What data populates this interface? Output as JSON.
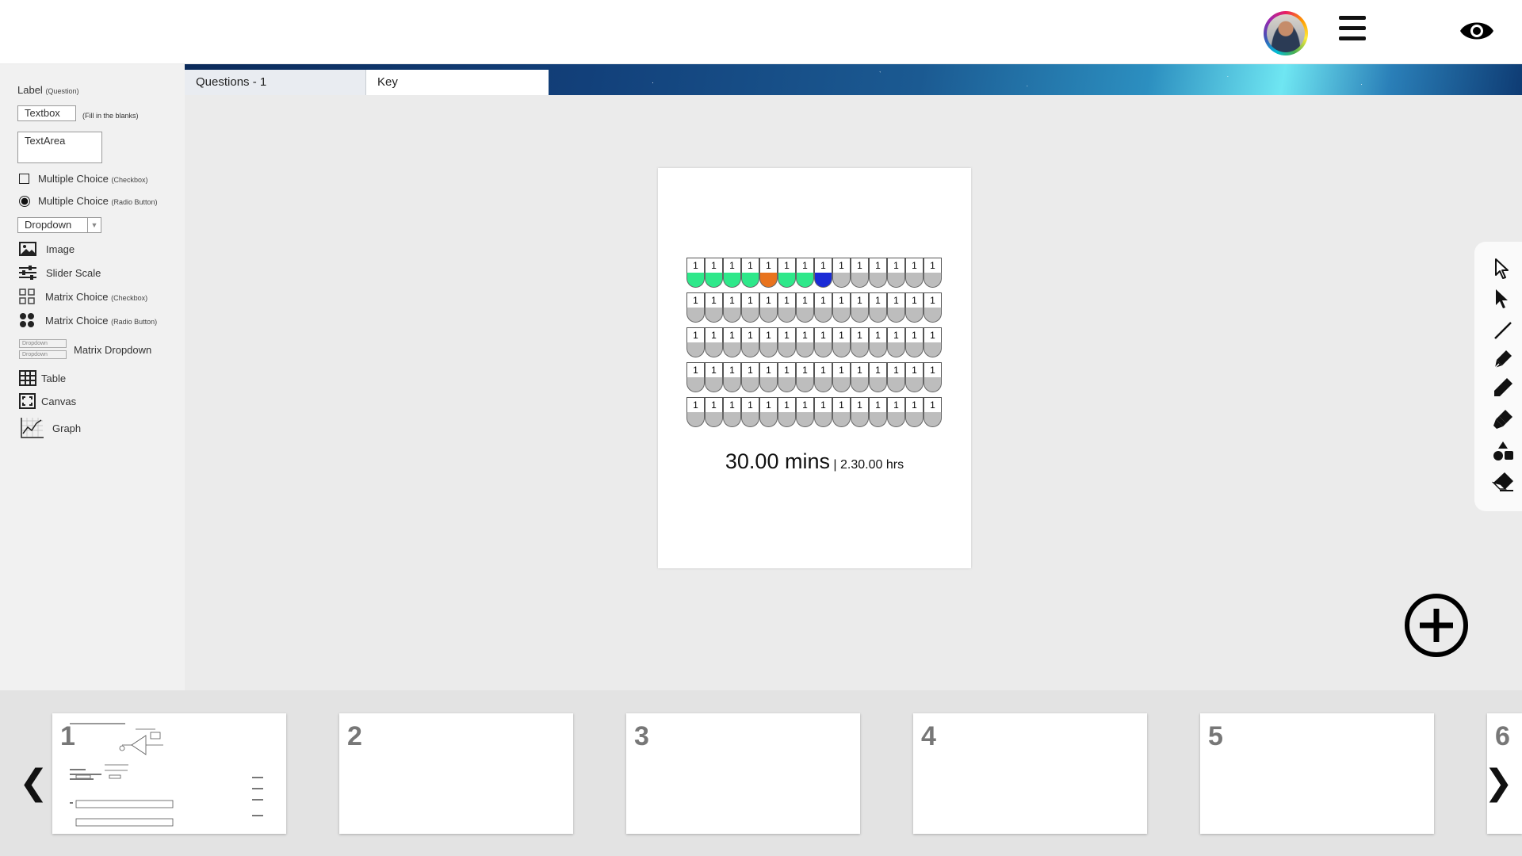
{
  "header": {
    "avatar_icon": "user-avatar",
    "menu_icon": "hamburger-menu-icon",
    "preview_icon": "eye-icon"
  },
  "tabs": [
    {
      "label": "Questions - 1"
    },
    {
      "label": "Key"
    }
  ],
  "sidebar": {
    "label_item": {
      "label": "Label",
      "hint": "(Question)"
    },
    "textbox": {
      "label": "Textbox",
      "hint": "(Fill in the blanks)"
    },
    "textarea": {
      "label": "TextArea"
    },
    "mc_checkbox": {
      "label": "Multiple Choice",
      "hint": "(Checkbox)"
    },
    "mc_radio": {
      "label": "Multiple Choice",
      "hint": "(Radio Button)"
    },
    "dropdown": {
      "label": "Dropdown"
    },
    "image": {
      "label": "Image"
    },
    "slider": {
      "label": "Slider Scale"
    },
    "matrix_checkbox": {
      "label": "Matrix Choice",
      "hint": "(Checkbox)"
    },
    "matrix_radio": {
      "label": "Matrix Choice",
      "hint": "(Radio Button)"
    },
    "matrix_dropdown": {
      "label": "Matrix Dropdown",
      "mini": "Dropdown"
    },
    "table": {
      "label": "Table"
    },
    "canvas": {
      "label": "Canvas"
    },
    "graph": {
      "label": "Graph"
    }
  },
  "page": {
    "grid": {
      "rows": 5,
      "cols": 14,
      "cell_label": "1",
      "row1_states": [
        "green",
        "green",
        "green",
        "green",
        "orange",
        "green",
        "green",
        "blue",
        "gray",
        "gray",
        "gray",
        "gray",
        "gray",
        "gray"
      ],
      "colors": {
        "green": "#2ee88a",
        "orange": "#e8731e",
        "blue": "#1a2bd6",
        "gray": "#bdbdbd"
      }
    },
    "timer": {
      "main": "30.00 mins",
      "separator": "|",
      "sub": "2.30.00 hrs"
    }
  },
  "toolbar": {
    "tools": [
      "select-outline-icon",
      "select-filled-icon",
      "line-icon",
      "pen-icon",
      "pencil-icon",
      "highlighter-icon",
      "shapes-icon",
      "eraser-icon"
    ]
  },
  "add_button": {
    "icon": "plus-circle-icon"
  },
  "filmstrip": {
    "pages": [
      "1",
      "2",
      "3",
      "4",
      "5",
      "6"
    ],
    "prev_label": "❮",
    "next_label": "❯"
  }
}
